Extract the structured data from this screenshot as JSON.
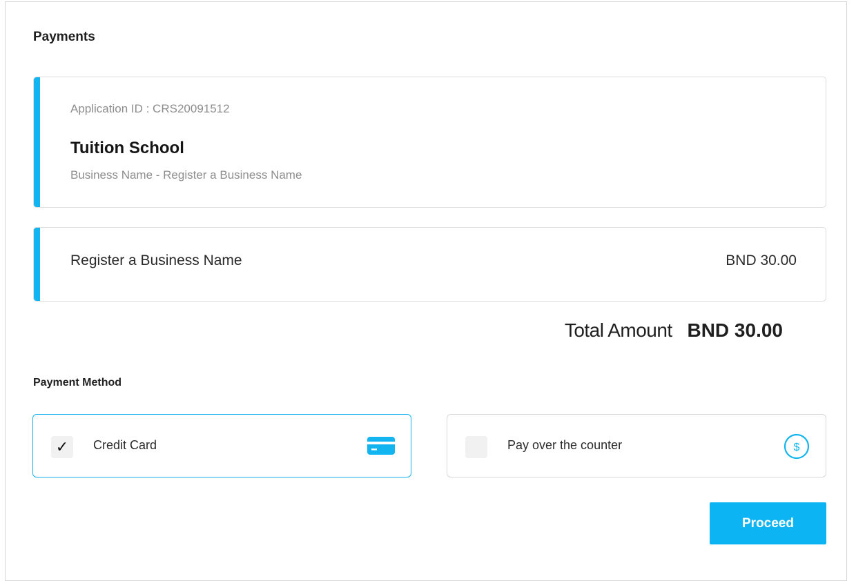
{
  "page": {
    "title": "Payments"
  },
  "application": {
    "id_text": "Application ID : CRS20091512",
    "name": "Tuition School",
    "type": "Business Name - Register a Business Name"
  },
  "fee": {
    "label": "Register a Business Name",
    "amount": "BND 30.00"
  },
  "total": {
    "label": "Total Amount",
    "value": "BND 30.00"
  },
  "payment_method": {
    "title": "Payment Method",
    "options": [
      {
        "label": "Credit Card",
        "selected": true,
        "check": "✓",
        "icon": "credit-card-icon"
      },
      {
        "label": "Pay over the counter",
        "selected": false,
        "check": "",
        "icon": "dollar-coin-icon"
      }
    ]
  },
  "actions": {
    "proceed_label": "Proceed"
  },
  "colors": {
    "accent": "#12b5f0",
    "button": "#0db4f3"
  }
}
